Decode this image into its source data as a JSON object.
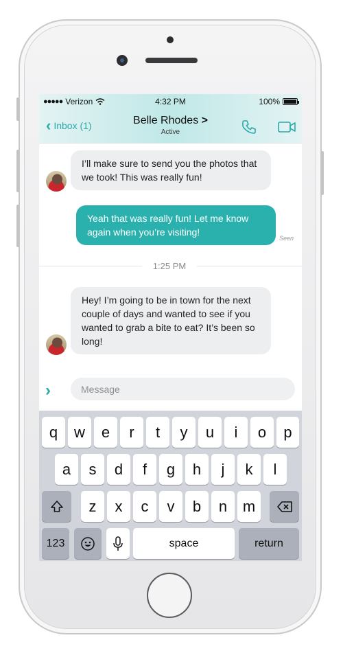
{
  "status": {
    "carrier": "Verizon",
    "time": "4:32 PM",
    "battery": "100%"
  },
  "header": {
    "back_label": "Inbox (1)",
    "contact_name": "Belle Rhodes",
    "contact_status": "Active",
    "chevron": ">"
  },
  "icons": {
    "back": "chevron-left-icon",
    "call": "phone-icon",
    "video": "video-camera-icon",
    "send": "chevron-right-icon"
  },
  "messages": [
    {
      "direction": "incoming",
      "text": "I’ll make sure to send you the photos that we took! This was really fun!"
    },
    {
      "direction": "outgoing",
      "text": "Yeah that was really fun! Let me know again when you’re visiting!",
      "receipt": "Seen"
    },
    {
      "direction": "incoming",
      "text": "Hey! I’m going to be in town for the next couple of days and wanted to see if you wanted to grab a bite to eat? It’s been so long!"
    }
  ],
  "divider_time": "1:25 PM",
  "compose": {
    "placeholder": "Message"
  },
  "keyboard": {
    "row1": [
      "q",
      "w",
      "e",
      "r",
      "t",
      "y",
      "u",
      "i",
      "o",
      "p"
    ],
    "row2": [
      "a",
      "s",
      "d",
      "f",
      "g",
      "h",
      "j",
      "k",
      "l"
    ],
    "row3": [
      "z",
      "x",
      "c",
      "v",
      "b",
      "n",
      "m"
    ],
    "numbers_label": "123",
    "space_label": "space",
    "return_label": "return"
  },
  "colors": {
    "accent": "#2bb1ad",
    "header_gradient": "#bfe8e7",
    "bubble_in": "#eceeef"
  }
}
